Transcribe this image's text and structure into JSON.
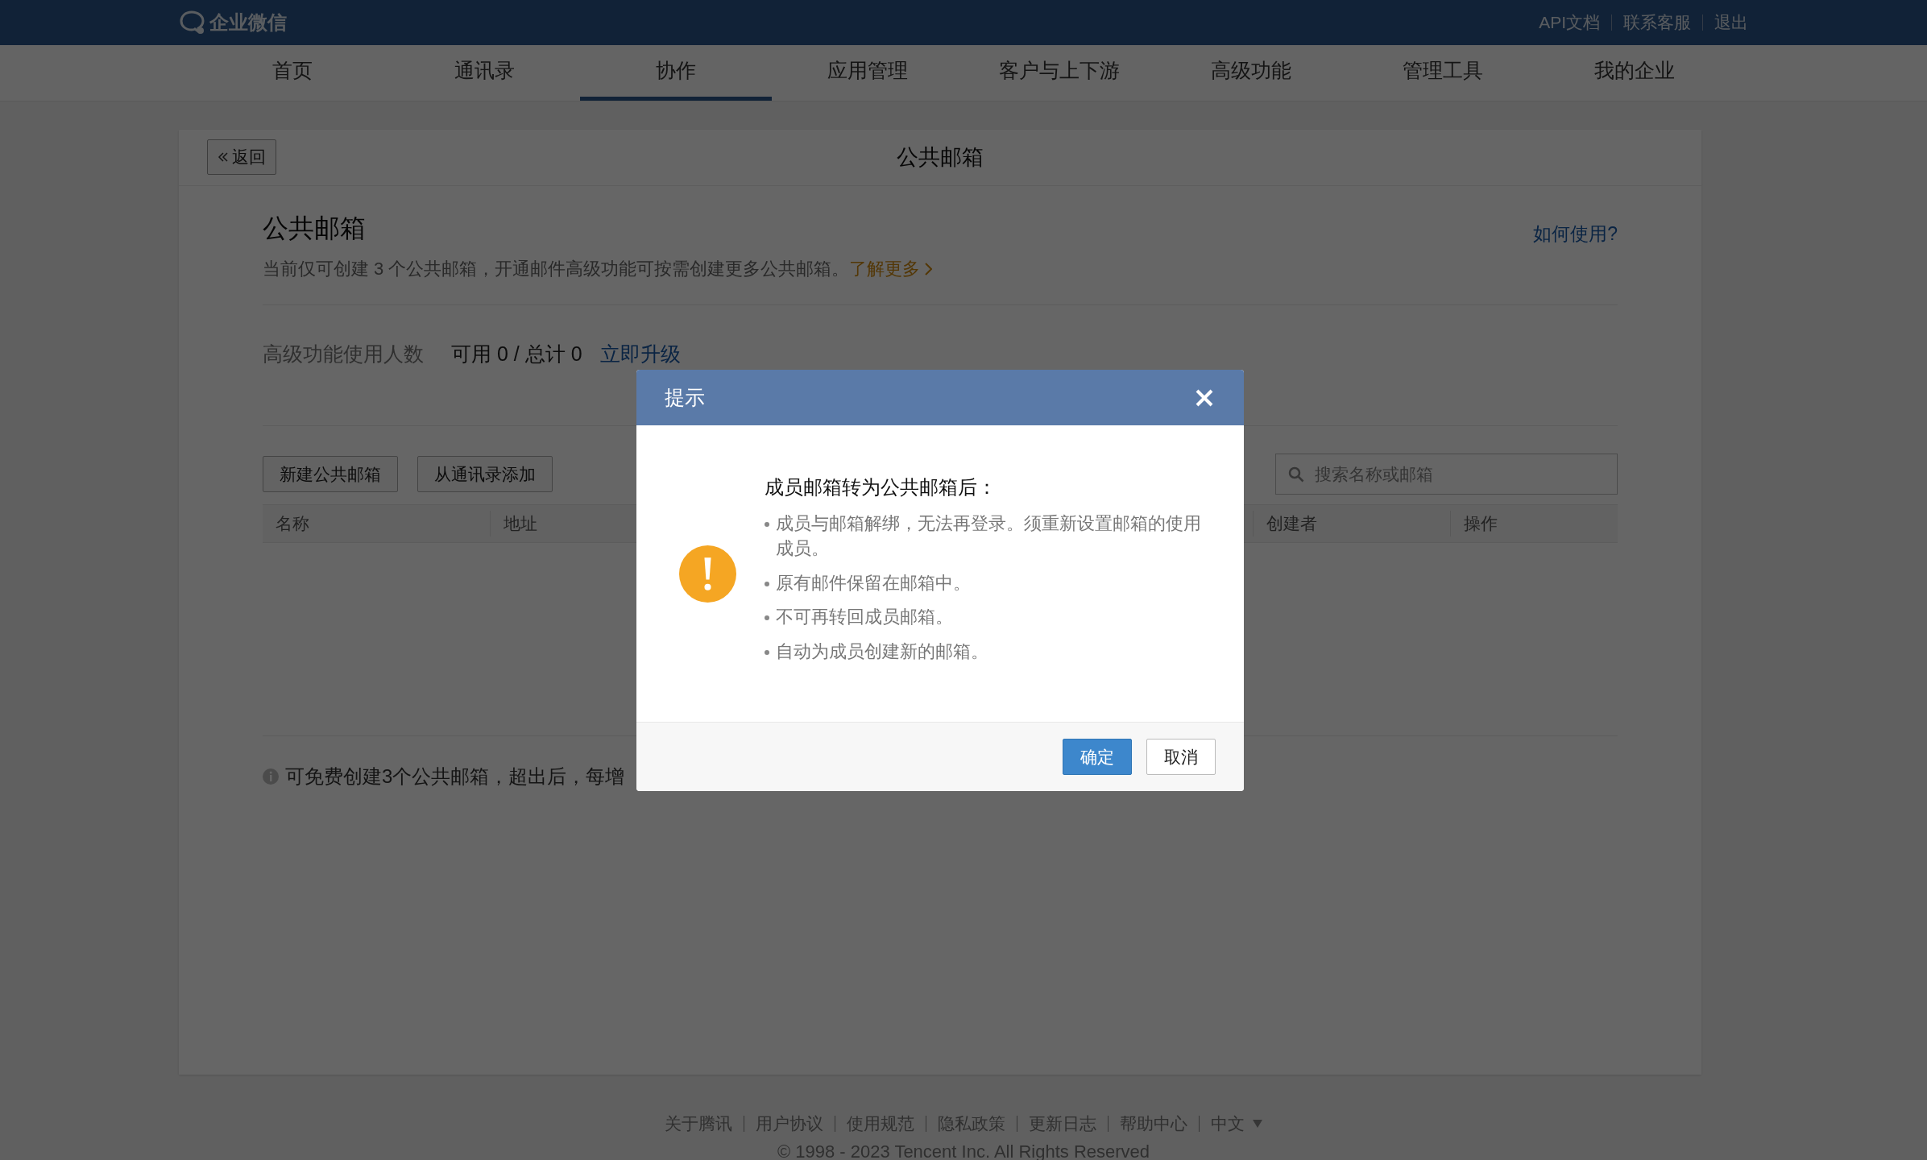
{
  "top_bar": {
    "logo_text": "企业微信",
    "links": [
      "API文档",
      "联系客服",
      "退出"
    ]
  },
  "nav": [
    {
      "label": "首页",
      "selected": false
    },
    {
      "label": "通讯录",
      "selected": false
    },
    {
      "label": "协作",
      "selected": true
    },
    {
      "label": "应用管理",
      "selected": false
    },
    {
      "label": "客户与上下游",
      "selected": false
    },
    {
      "label": "高级功能",
      "selected": false
    },
    {
      "label": "管理工具",
      "selected": false
    },
    {
      "label": "我的企业",
      "selected": false
    }
  ],
  "card": {
    "back_button": "返回",
    "title": "公共邮箱"
  },
  "section": {
    "heading": "公共邮箱",
    "help_link": "如何使用?",
    "description": "当前仅可创建 3 个公共邮箱，开通邮件高级功能可按需创建更多公共邮箱。",
    "learn_more": "了解更多"
  },
  "usage": {
    "label": "高级功能使用人数",
    "value": "可用 0 / 总计 0",
    "upgrade_link": "立即升级"
  },
  "actions": [
    "新建公共邮箱",
    "从通讯录添加"
  ],
  "search": {
    "placeholder": "搜索名称或邮箱"
  },
  "table": {
    "columns": [
      "名称",
      "地址",
      "创建者",
      "操作"
    ]
  },
  "note": "可免费创建3个公共邮箱，超出后，每增",
  "footer": {
    "links": [
      "关于腾讯",
      "用户协议",
      "使用规范",
      "隐私政策",
      "更新日志",
      "帮助中心",
      "中文"
    ],
    "copyright": "© 1998 - 2023 Tencent Inc. All Rights Reserved"
  },
  "dialog": {
    "title": "提示",
    "heading": "成员邮箱转为公共邮箱后：",
    "bullets": [
      "成员与邮箱解绑，无法再登录。须重新设置邮箱的使用成员。",
      "原有邮件保留在邮箱中。",
      "不可再转回成员邮箱。",
      "自动为成员创建新的邮箱。"
    ],
    "confirm": "确定",
    "cancel": "取消"
  }
}
